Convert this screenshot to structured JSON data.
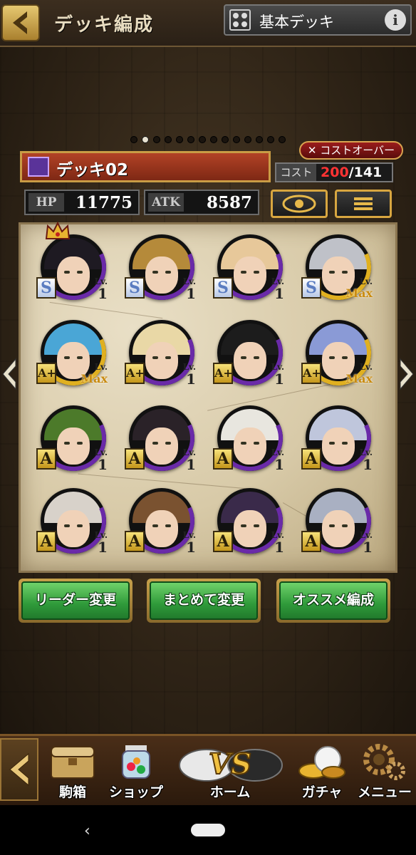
{
  "header": {
    "title": "デッキ編成",
    "deck_selector": "基本デッキ",
    "info": "i"
  },
  "pager": {
    "total": 14,
    "active": 1
  },
  "deck": {
    "name": "デッキ02",
    "cost_over": "✕ コストオーバー",
    "cost_label": "コスト",
    "cost_used": "200",
    "cost_max": "/141",
    "hp_label": "HP",
    "hp": "11775",
    "atk_label": "ATK",
    "atk": "8587"
  },
  "units": [
    {
      "rank": "S",
      "lv": "1",
      "hair": "#1e1a22",
      "arc": "#6a2aa8",
      "leader": true
    },
    {
      "rank": "S",
      "lv": "1",
      "hair": "#b58a3a",
      "arc": "#6a2aa8"
    },
    {
      "rank": "S",
      "lv": "1",
      "hair": "#e7c89a",
      "arc": "#6a2aa8"
    },
    {
      "rank": "S",
      "lv": "Max",
      "hair": "#bfc1c8",
      "arc": "#e0b020"
    },
    {
      "rank": "A+",
      "lv": "Max",
      "hair": "#4aa6d6",
      "arc": "#e0b020"
    },
    {
      "rank": "A+",
      "lv": "1",
      "hair": "#e9d8a6",
      "arc": "#6a2aa8"
    },
    {
      "rank": "A+",
      "lv": "1",
      "hair": "#1c1c1c",
      "arc": "#6a2aa8"
    },
    {
      "rank": "A+",
      "lv": "Max",
      "hair": "#8a9ad6",
      "arc": "#e0b020"
    },
    {
      "rank": "A",
      "lv": "1",
      "hair": "#4c7a2a",
      "arc": "#6a2aa8"
    },
    {
      "rank": "A",
      "lv": "1",
      "hair": "#2a2228",
      "arc": "#6a2aa8"
    },
    {
      "rank": "A",
      "lv": "1",
      "hair": "#e8e6df",
      "arc": "#6a2aa8"
    },
    {
      "rank": "A",
      "lv": "1",
      "hair": "#bfc6dc",
      "arc": "#6a2aa8"
    },
    {
      "rank": "A",
      "lv": "1",
      "hair": "#d8d2ca",
      "arc": "#6a2aa8"
    },
    {
      "rank": "A",
      "lv": "1",
      "hair": "#7a5230",
      "arc": "#6a2aa8"
    },
    {
      "rank": "A",
      "lv": "1",
      "hair": "#3a2a4a",
      "arc": "#6a2aa8"
    },
    {
      "rank": "A",
      "lv": "1",
      "hair": "#a9b0c2",
      "arc": "#6a2aa8"
    }
  ],
  "lv_prefix": "Lv.",
  "actions": {
    "leader": "リーダー変更",
    "bulk": "まとめて変更",
    "recommend": "オススメ編成"
  },
  "nav": {
    "box": "駒箱",
    "shop": "ショップ",
    "home": "ホーム",
    "gacha": "ガチャ",
    "menu": "メニュー",
    "vs": "VS"
  },
  "icons": {
    "back": "back-arrow-icon",
    "eye": "eye-icon",
    "menu": "list-icon"
  }
}
